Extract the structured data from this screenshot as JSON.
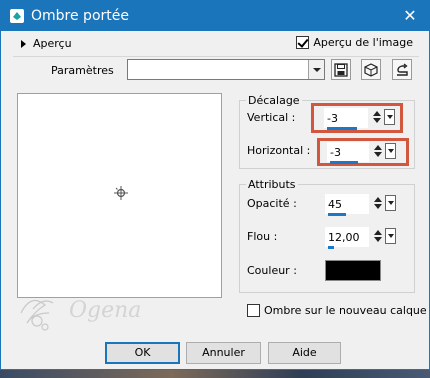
{
  "window": {
    "title": "Ombre portée",
    "close_icon": "close-icon"
  },
  "preview_bar": {
    "apercu_label": "Aperçu",
    "preview_checkbox_label": "Aperçu de l'image",
    "preview_checked": true
  },
  "params": {
    "label": "Paramètres",
    "selected_value": ""
  },
  "decalage": {
    "group_title": "Décalage",
    "vertical_label": "Vertical :",
    "vertical_value": "-3",
    "horizontal_label": "Horizontal :",
    "horizontal_value": "-3"
  },
  "attributs": {
    "group_title": "Attributs",
    "opacite_label": "Opacité :",
    "opacite_value": "45",
    "flou_label": "Flou :",
    "flou_value": "12,00",
    "couleur_label": "Couleur :",
    "couleur_value": "#000000"
  },
  "shadow_option": {
    "label": "Ombre sur le nouveau calque",
    "checked": false
  },
  "buttons": {
    "ok": "OK",
    "annuler": "Annuler",
    "aide": "Aide"
  },
  "watermark": {
    "text": "Ogena"
  },
  "colors": {
    "title_bar": "#1b75bb",
    "highlight_box": "#d2573f",
    "slider_accent": "#1b78c8"
  }
}
